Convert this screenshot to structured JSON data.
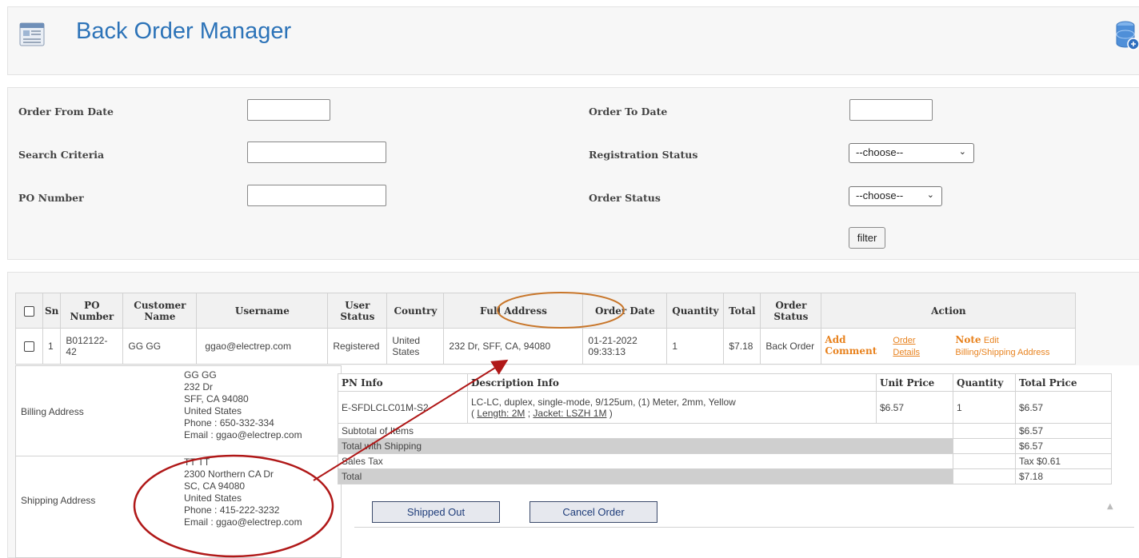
{
  "header": {
    "title": "Back Order Manager",
    "app_icon": "document-list-icon",
    "right_icon": "database-icon"
  },
  "filters": {
    "order_from_date_label": "Order From Date",
    "order_to_date_label": "Order To Date",
    "search_criteria_label": "Search Criteria",
    "registration_status_label": "Registration Status",
    "registration_status_value": "--choose--",
    "po_number_label": "PO Number",
    "order_status_label": "Order Status",
    "order_status_value": "--choose--",
    "filter_button": "filter"
  },
  "table": {
    "headers": {
      "sn": "Sn",
      "po_number": "PO Number",
      "customer_name": "Customer Name",
      "username": "Username",
      "user_status": "User Status",
      "country": "Country",
      "full_address": "Full Address",
      "order_date": "Order Date",
      "quantity": "Quantity",
      "total": "Total",
      "order_status": "Order Status",
      "action": "Action"
    },
    "rows": [
      {
        "sn": "1",
        "po_number": "B012122-42",
        "customer_name": "GG GG",
        "username": "ggao@electrep.com",
        "user_status": "Registered",
        "country": "United States",
        "full_address": "232 Dr, SFF, CA, 94080",
        "order_date": "01-21-2022 09:33:13",
        "quantity": "1",
        "total": "$7.18",
        "order_status": "Back Order",
        "action_add_comment": "Add Comment",
        "action_order_details": "Order Details",
        "action_note": "Note",
        "action_edit": "Edit",
        "action_billing": "Billing/Shipping Address"
      }
    ]
  },
  "billing": {
    "label": "Billing Address",
    "name": "GG GG",
    "street": "232 Dr",
    "city": "SFF, CA 94080",
    "country": "United States",
    "phone": "Phone : 650-332-334",
    "email": "Email : ggao@electrep.com"
  },
  "shipping": {
    "label": "Shipping Address",
    "name": "TT TT",
    "street": "2300 Northern CA Dr",
    "city": "SC, CA 94080",
    "country": "United States",
    "phone": "Phone : 415-222-3232",
    "email": "Email : ggao@electrep.com"
  },
  "items": {
    "headers": {
      "pn_info": "PN Info",
      "description": "Description Info",
      "unit_price": "Unit Price",
      "quantity": "Quantity",
      "total_price": "Total Price"
    },
    "rows": [
      {
        "pn": "E-SFDLCLC01M-S2",
        "description": "LC-LC, duplex, single-mode, 9/125um, (1) Meter, 2mm, Yellow",
        "length": "Length: 2M",
        "jacket": "Jacket: LSZH 1M",
        "unit_price": "$6.57",
        "quantity": "1",
        "total_price": "$6.57"
      }
    ],
    "subtotal_label": "Subtotal of Items",
    "subtotal_value": "$6.57",
    "total_shipping_label": "Total with Shipping",
    "total_shipping_value": "$6.57",
    "sales_tax_label": "Sales Tax",
    "sales_tax_value": "Tax $0.61",
    "total_label": "Total",
    "total_value": "$7.18"
  },
  "buttons": {
    "shipped_out": "Shipped Out",
    "cancel_order": "Cancel Order"
  },
  "colors": {
    "title_blue": "#2c73b8",
    "action_orange": "#e8821e",
    "annotation_red": "#b01818",
    "annotation_orange": "#c8762a"
  }
}
